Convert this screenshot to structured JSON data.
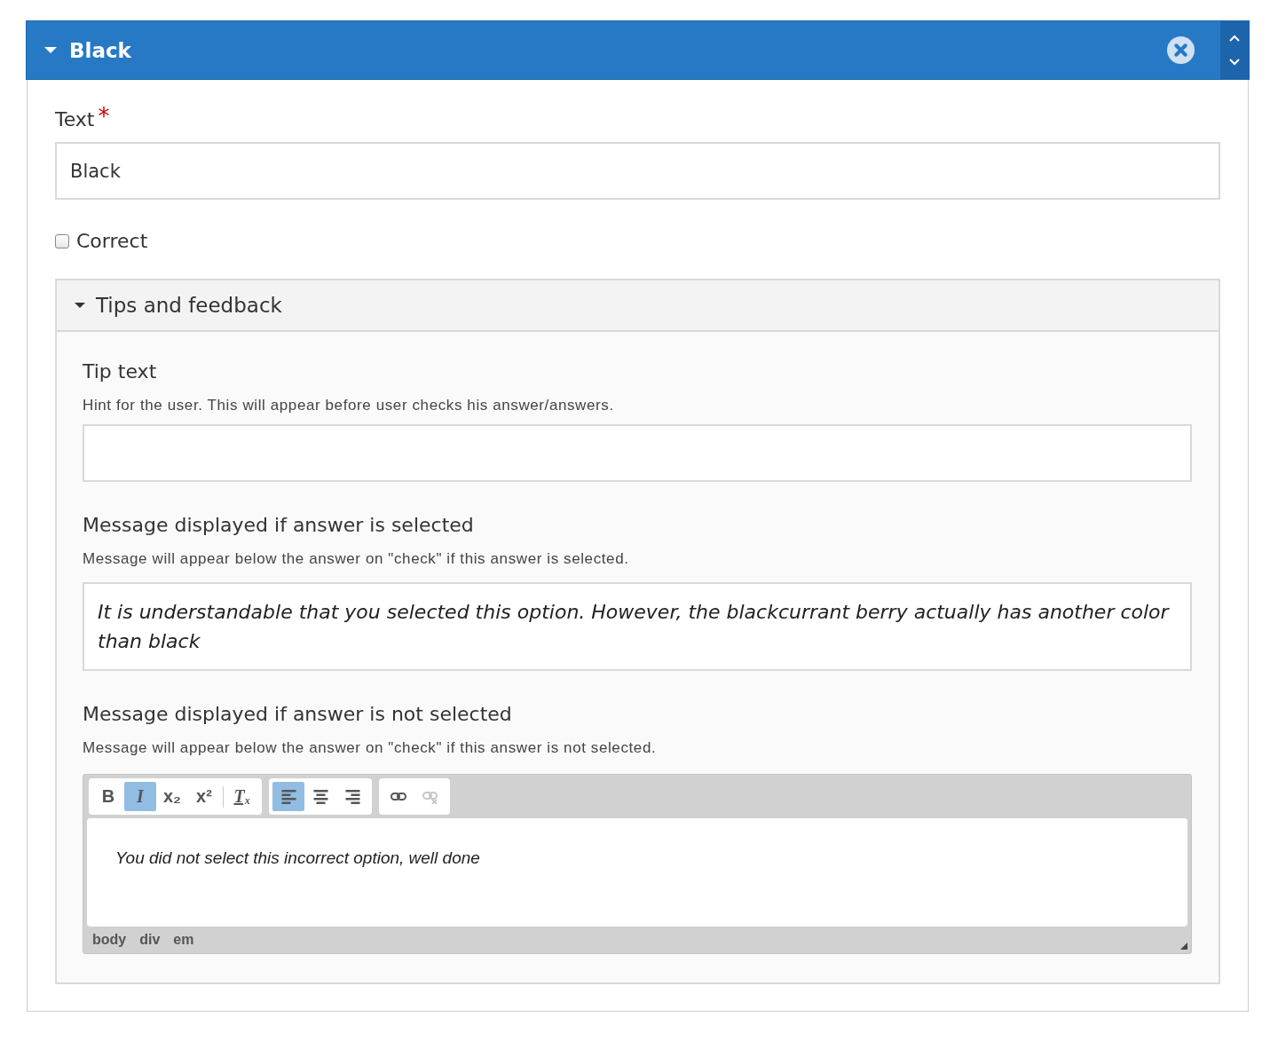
{
  "group": {
    "title": "Black",
    "expanded": true
  },
  "fields": [
    {
      "kind": "text",
      "label": "Text",
      "required": true,
      "required_mark": "*",
      "value": "Black"
    },
    {
      "kind": "checkbox",
      "label": "Correct",
      "checked": false
    }
  ],
  "tips": {
    "title": "Tips and feedback",
    "expanded": true,
    "fields": [
      {
        "kind": "text",
        "label": "Tip text",
        "description": "Hint for the user. This will appear before user checks his answer/answers."
      },
      {
        "kind": "richtext",
        "label": "Message displayed if answer is selected",
        "description": "Message will appear below the answer on \"check\" if this answer is selected.",
        "value": "It is understandable that you selected this option. However, the blackcurrant berry actually has another color than black"
      },
      {
        "kind": "editor",
        "label": "Message displayed if answer is not selected",
        "description": "Message will appear below the answer on \"check\" if this answer is not selected.",
        "value": "You did not select this incorrect option, well done",
        "toolbar": [
          [
            {
              "kind": "bold",
              "label": "B",
              "active": false,
              "disabled": false
            },
            {
              "kind": "italic",
              "label": "I",
              "active": true,
              "disabled": false
            },
            {
              "kind": "subscript",
              "label": "x₂",
              "active": false,
              "disabled": false
            },
            {
              "kind": "superscript",
              "label": "x²",
              "active": false,
              "disabled": false
            },
            {
              "kind": "separator"
            },
            {
              "kind": "remove-format",
              "label": "Tₓ",
              "active": false,
              "disabled": false
            }
          ],
          [
            {
              "kind": "align-left",
              "active": true,
              "disabled": false
            },
            {
              "kind": "align-center",
              "active": false,
              "disabled": false
            },
            {
              "kind": "align-right",
              "active": false,
              "disabled": false
            }
          ],
          [
            {
              "kind": "link",
              "active": false,
              "disabled": false
            },
            {
              "kind": "unlink",
              "active": false,
              "disabled": true
            }
          ]
        ],
        "path": [
          "body",
          "div",
          "em"
        ]
      }
    ]
  }
}
